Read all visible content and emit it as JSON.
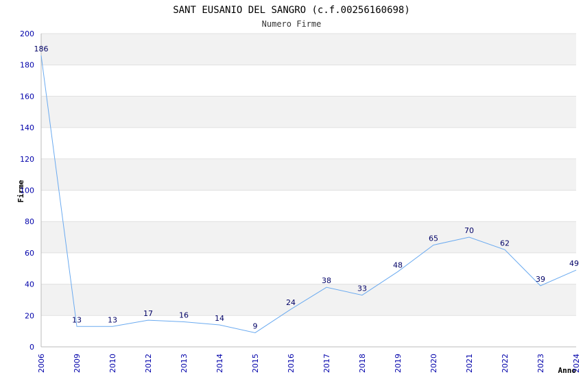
{
  "chart_data": {
    "type": "line",
    "title": "SANT EUSANIO DEL SANGRO (c.f.00256160698)",
    "subtitle": "Numero Firme",
    "xlabel": "Anno",
    "ylabel": "Firme",
    "categories": [
      "2006",
      "2009",
      "2010",
      "2012",
      "2013",
      "2014",
      "2015",
      "2016",
      "2017",
      "2018",
      "2019",
      "2020",
      "2021",
      "2022",
      "2023",
      "2024"
    ],
    "series": [
      {
        "values": [
          186,
          13,
          13,
          17,
          16,
          14,
          9,
          24,
          38,
          33,
          48,
          65,
          70,
          62,
          39,
          49
        ]
      }
    ],
    "ylim": [
      0,
      200
    ],
    "yticks": [
      0,
      20,
      40,
      60,
      80,
      100,
      120,
      140,
      160,
      180,
      200
    ],
    "grid": true,
    "colors": {
      "line": "#6aaaf0",
      "band": "#f2f2f2",
      "tick_text": "#0000aa",
      "label_text": "#000066"
    }
  }
}
